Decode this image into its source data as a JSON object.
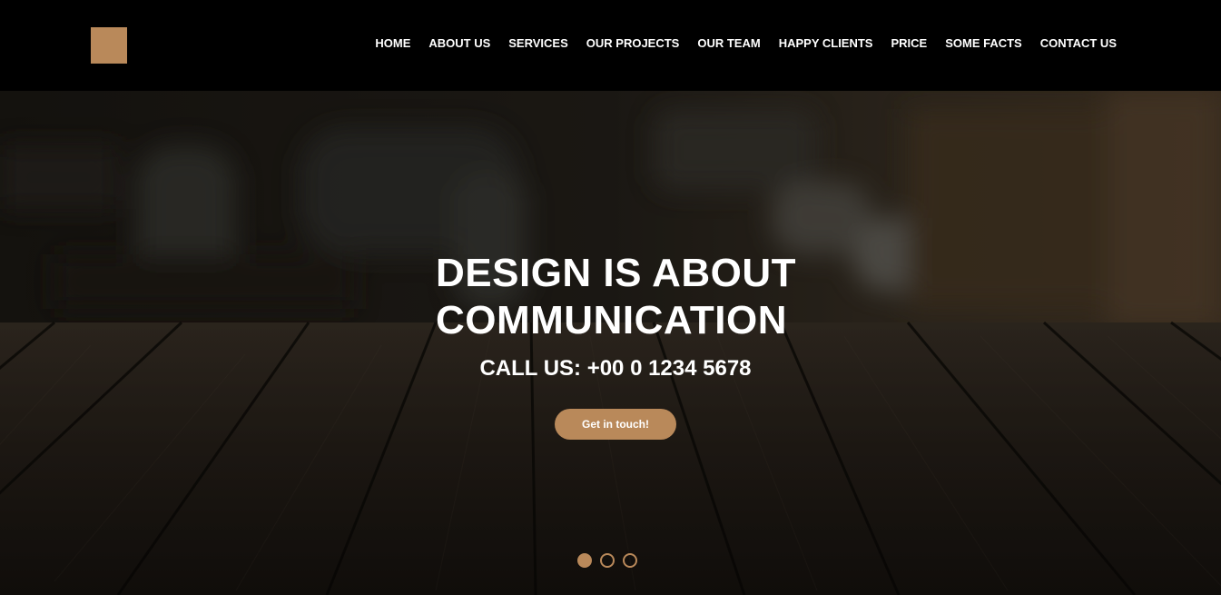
{
  "brand": {
    "accent_color": "#b9895a",
    "logo_icon": "square-logo-icon"
  },
  "nav": {
    "items": [
      {
        "label": "HOME"
      },
      {
        "label": "ABOUT US"
      },
      {
        "label": "SERVICES"
      },
      {
        "label": "OUR PROJECTS"
      },
      {
        "label": "OUR TEAM"
      },
      {
        "label": "HAPPY CLIENTS"
      },
      {
        "label": "PRICE"
      },
      {
        "label": "SOME FACTS"
      },
      {
        "label": "CONTACT US"
      }
    ]
  },
  "hero": {
    "headline_line1": "DESIGN IS ABOUT",
    "headline_line2": "COMMUNICATION",
    "callus": "CALL US: +00 0 1234 5678",
    "cta_label": "Get in touch!",
    "slides_total": 3,
    "active_slide": 1
  }
}
